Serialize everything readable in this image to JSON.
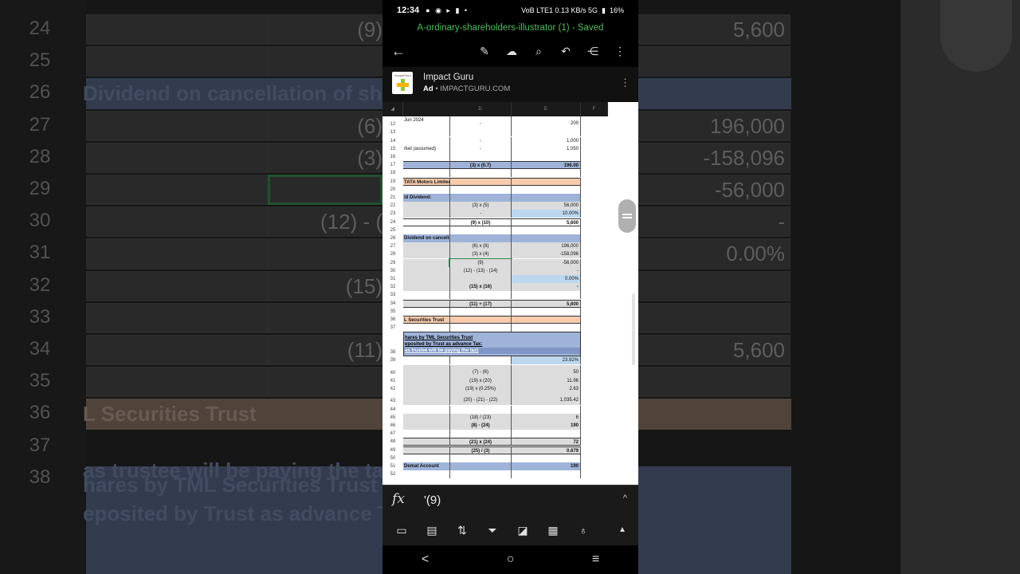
{
  "background": {
    "row_numbers": [
      "24",
      "25",
      "26",
      "27",
      "28",
      "29",
      "30",
      "31",
      "32",
      "33",
      "34",
      "35",
      "36",
      "37",
      "38"
    ],
    "left_texts": [
      {
        "row": "26",
        "text": "Dividend on cancellation of sha"
      },
      {
        "row": "36",
        "text": "L Securities Trust"
      },
      {
        "row": "37a",
        "text": "hares by TML Securities Trust"
      },
      {
        "row": "37b",
        "text": "eposited by Trust as advance Ta"
      },
      {
        "row": "38",
        "text": "as trustee will be paying the ta"
      }
    ],
    "mid_texts": [
      {
        "row": "24",
        "text": "(9)"
      },
      {
        "row": "27",
        "text": "(6)"
      },
      {
        "row": "28",
        "text": "(3)"
      },
      {
        "row": "30",
        "text": "(12) - ("
      },
      {
        "row": "32",
        "text": "(15)"
      },
      {
        "row": "34",
        "text": "(11)"
      }
    ],
    "right_values": [
      {
        "row": "24",
        "text": "5,600"
      },
      {
        "row": "27",
        "text": "196,000"
      },
      {
        "row": "28",
        "text": "-158,096"
      },
      {
        "row": "29",
        "text": "-56,000"
      },
      {
        "row": "30",
        "text": "-"
      },
      {
        "row": "31",
        "text": "0.00%"
      },
      {
        "row": "34",
        "text": "5,600"
      }
    ]
  },
  "status_bar": {
    "time": "12:34",
    "left_icons": "● ◉ ▸ ▮ •",
    "network": "VoB LTE1 0.13 KB/s 5G",
    "battery": "16%"
  },
  "document": {
    "title": "A-ordinary-shareholders-illustrator (1) - Saved"
  },
  "toolbar": {
    "back_icon": "←",
    "tools": [
      {
        "name": "draw-icon",
        "glyph": "✎"
      },
      {
        "name": "cloud-upload-icon",
        "glyph": "☁"
      },
      {
        "name": "search-icon",
        "glyph": "⌕"
      },
      {
        "name": "undo-icon",
        "glyph": "↶"
      },
      {
        "name": "share-icon",
        "glyph": "⋲"
      },
      {
        "name": "more-icon",
        "glyph": "⋮"
      }
    ]
  },
  "ad": {
    "brand_small": "ImpactGuru",
    "title": "Impact Guru",
    "label": "Ad",
    "domain": "• IMPACTGURU.COM",
    "more_icon": "⋮"
  },
  "sheet": {
    "columns": [
      "D",
      "E",
      "F"
    ],
    "rows": [
      {
        "n": "12",
        "a": "Jun 2024",
        "b": "-",
        "c": "200",
        "style": "tall"
      },
      {
        "n": "13",
        "a": "",
        "b": "",
        "c": "",
        "style": ""
      },
      {
        "n": "14",
        "a": "",
        "b": "-",
        "c": "1,000",
        "style": ""
      },
      {
        "n": "15",
        "a": "rket (assumed)",
        "b": "-",
        "c": "1,050",
        "style": ""
      },
      {
        "n": "16",
        "a": "",
        "b": "",
        "c": "",
        "style": ""
      },
      {
        "n": "17",
        "a": "",
        "b": "(3) x (0.7)",
        "c": "196.00",
        "style": "blue bold bordered"
      },
      {
        "n": "18",
        "a": "",
        "b": "",
        "c": "",
        "style": ""
      },
      {
        "n": "19",
        "a": "TATA Motors Limited",
        "b": "",
        "c": "",
        "style": "peach bold bordered"
      },
      {
        "n": "20",
        "a": "",
        "b": "",
        "c": "",
        "style": ""
      },
      {
        "n": "21",
        "a": "id Dividend:",
        "b": "",
        "c": "",
        "style": "blue bold"
      },
      {
        "n": "22",
        "a": "",
        "b": "(3) x (5)",
        "c": "56,000",
        "style": "gray"
      },
      {
        "n": "23",
        "a": "",
        "b": "-",
        "c": "10.00%",
        "style": "gray lightblue"
      },
      {
        "n": "24",
        "a": "",
        "b": "(9) x (10)",
        "c": "5,600",
        "style": "bold bordered"
      },
      {
        "n": "25",
        "a": "",
        "b": "",
        "c": "",
        "style": ""
      },
      {
        "n": "26",
        "a": "Dividend on cancellation of shares:",
        "b": "",
        "c": "",
        "style": "blue bold"
      },
      {
        "n": "27",
        "a": "",
        "b": "(6) x (8)",
        "c": "196,000",
        "style": "gray"
      },
      {
        "n": "28",
        "a": "",
        "b": "(3) x (4)",
        "c": "-158,096",
        "style": "gray"
      },
      {
        "n": "29",
        "a": "",
        "b": "(9)",
        "c": "-56,000",
        "style": "gray sel"
      },
      {
        "n": "30",
        "a": "",
        "b": "(12) - (13) - (14)",
        "c": "-",
        "style": "gray"
      },
      {
        "n": "31",
        "a": "",
        "b": "",
        "c": "0.00%",
        "style": "gray lightblue"
      },
      {
        "n": "32",
        "a": "",
        "b": "(15) x (16)",
        "c": "-",
        "style": "gray bold"
      },
      {
        "n": "33",
        "a": "",
        "b": "",
        "c": "",
        "style": ""
      },
      {
        "n": "34",
        "a": "",
        "b": "(11) + (17)",
        "c": "5,600",
        "style": "gray bold bordered"
      },
      {
        "n": "35",
        "a": "",
        "b": "",
        "c": "",
        "style": ""
      },
      {
        "n": "36",
        "a": "L Securities Trust",
        "b": "",
        "c": "",
        "style": "peach bold bordered"
      },
      {
        "n": "37",
        "a": "",
        "b": "",
        "c": "",
        "style": ""
      }
    ],
    "block38": {
      "n": "38",
      "lines": [
        "hares by TML Securities Trust",
        "eposited by Trust as advance Tax:",
        "as trustee will be paying the tax)"
      ]
    },
    "rows2": [
      {
        "n": "39",
        "a": "",
        "b": "",
        "c": "23.92%",
        "style": "lightblue"
      },
      {
        "n": "40",
        "a": "",
        "b": "(7) - (6)",
        "c": "50",
        "style": "gray tall"
      },
      {
        "n": "41",
        "a": "",
        "b": "(19) x (20)",
        "c": "11.96",
        "style": "gray"
      },
      {
        "n": "42",
        "a": "",
        "b": "(19) x (0.25%)",
        "c": "2.63",
        "style": "gray"
      },
      {
        "n": "43",
        "a": "",
        "b": "(20) - (21) - (22)",
        "c": "1,035.42",
        "style": "gray tall"
      },
      {
        "n": "44",
        "a": "",
        "b": "",
        "c": "",
        "style": ""
      },
      {
        "n": "45",
        "a": "",
        "b": "(18) / (23)",
        "c": "6",
        "style": "gray"
      },
      {
        "n": "46",
        "a": "",
        "b": "(8) - (24)",
        "c": "190",
        "style": "gray bold"
      },
      {
        "n": "47",
        "a": "",
        "b": "",
        "c": "",
        "style": ""
      },
      {
        "n": "48",
        "a": "",
        "b": "(21) x (24)",
        "c": "72",
        "style": "gray bold bordered"
      },
      {
        "n": "49",
        "a": "",
        "b": "(25) / (3)",
        "c": "0.679",
        "style": "gray bold bordered"
      },
      {
        "n": "50",
        "a": "",
        "b": "",
        "c": "",
        "style": ""
      },
      {
        "n": "51",
        "a": "Demat Account",
        "b": "",
        "c": "190",
        "style": "blue bold"
      },
      {
        "n": "52",
        "a": "",
        "b": "",
        "c": "",
        "style": ""
      }
    ]
  },
  "formula_bar": {
    "fx_label": "fx",
    "value": "'(9)",
    "caret": "^"
  },
  "bottom_toolbar": [
    {
      "name": "sheet-view-icon",
      "glyph": "▭"
    },
    {
      "name": "table-icon",
      "glyph": "▤"
    },
    {
      "name": "sort-icon",
      "glyph": "⇅"
    },
    {
      "name": "filter-icon",
      "glyph": "⏷"
    },
    {
      "name": "fill-icon",
      "glyph": "◪"
    },
    {
      "name": "grid-icon",
      "glyph": "▦"
    },
    {
      "name": "idea-icon",
      "glyph": "♁"
    }
  ],
  "nav": {
    "back": "<",
    "home": "○",
    "recents": "≡"
  }
}
